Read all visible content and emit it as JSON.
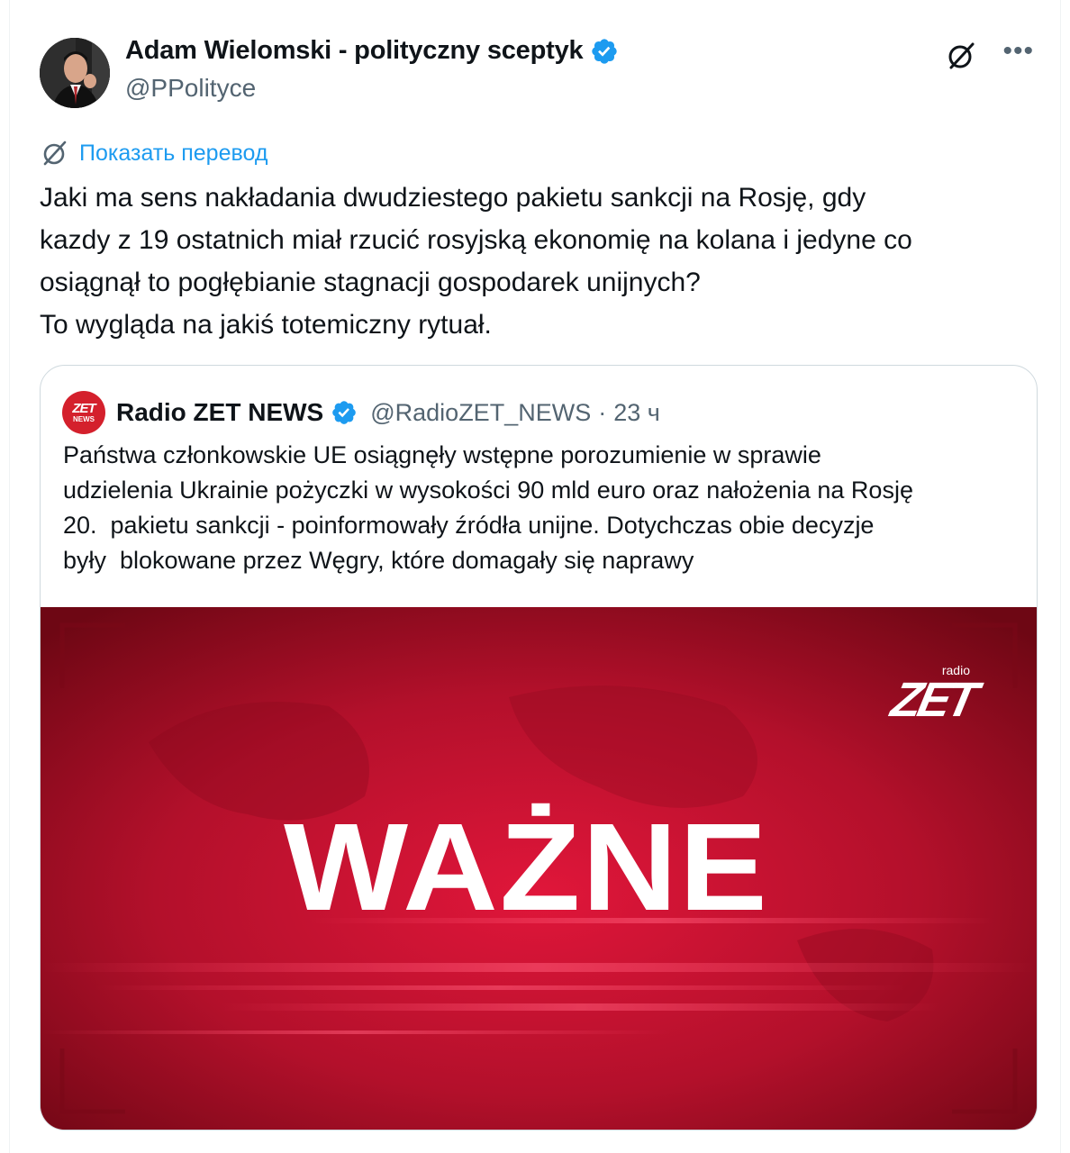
{
  "post": {
    "display_name": "Adam Wielomski - polityczny sceptyk",
    "handle": "@PPolityce",
    "translate_label": "Показать перевод",
    "text_lines": [
      "Jaki ma sens nakładania dwudziestego pakietu sankcji na Rosję, gdy",
      "kazdy z 19 ostatnich miał rzucić rosyjską ekonomię na kolana i jedyne co",
      "osiągnął to pogłębianie stagnacji gospodarek unijnych?",
      "To wygląda na jakiś totemiczny rytuał."
    ]
  },
  "quote": {
    "avatar_line1": "ZET",
    "avatar_line2": "NEWS",
    "display_name": "Radio ZET NEWS",
    "handle": "@RadioZET_NEWS",
    "separator": "·",
    "time": "23 ч",
    "text_lines": [
      "Państwa członkowskie UE osiągnęły wstępne porozumienie w sprawie",
      "udzielenia Ukrainie pożyczki w wysokości 90 mld euro oraz nałożenia na Rosję",
      "20.  pakietu sankcji - poinformowały źródła unijne. Dotychczas obie decyzje",
      "były  blokowane przez Węgry, które domagały się naprawy"
    ],
    "image": {
      "headline": "WAŻNE",
      "logo_small": "radio",
      "logo_main": "ZET"
    }
  },
  "icons": {
    "verified": "verified-badge-icon",
    "grok": "grok-icon",
    "more": "more-icon",
    "translate": "translate-icon"
  },
  "colors": {
    "accent": "#1d9bf0",
    "text": "#0f1419",
    "secondary": "#536471",
    "border": "#cfd9de",
    "image_red": "#b0122a"
  }
}
